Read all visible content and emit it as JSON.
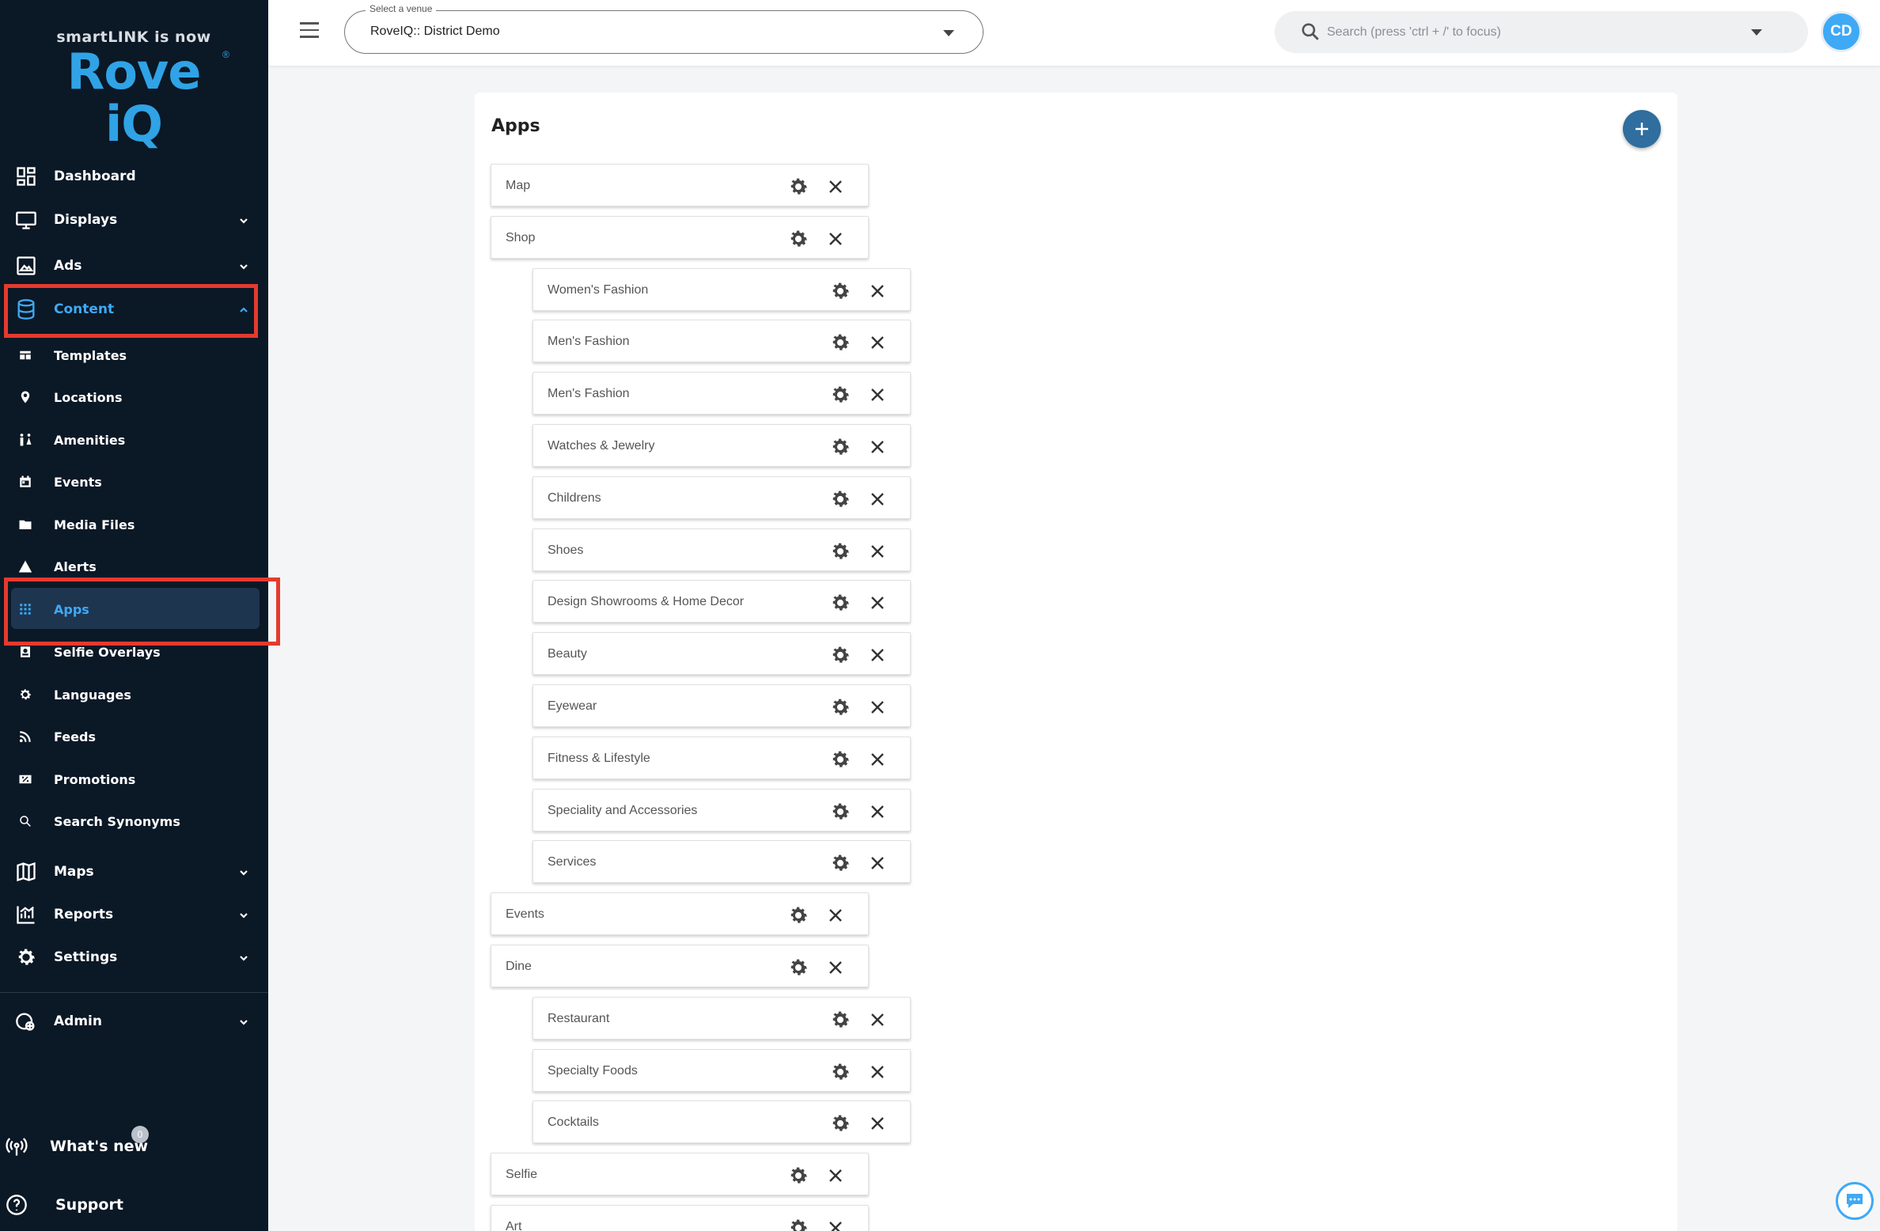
{
  "logo": {
    "tagline": "smartLINK is now",
    "brand": "Rove iQ",
    "reg": "®"
  },
  "topbar": {
    "venue_legend": "Select a venue",
    "venue_value": "RoveIQ:: District Demo",
    "search_placeholder": "Search (press 'ctrl + /' to focus)",
    "avatar_initials": "CD"
  },
  "sidebar": {
    "main": [
      {
        "label": "Dashboard",
        "icon": "dashboard-icon"
      },
      {
        "label": "Displays",
        "icon": "monitor-icon"
      },
      {
        "label": "Ads",
        "icon": "image-icon"
      },
      {
        "label": "Content",
        "icon": "database-icon"
      }
    ],
    "content_sub": [
      {
        "label": "Templates",
        "icon": "template-icon"
      },
      {
        "label": "Locations",
        "icon": "pin-icon"
      },
      {
        "label": "Amenities",
        "icon": "restroom-icon"
      },
      {
        "label": "Events",
        "icon": "calendar-icon"
      },
      {
        "label": "Media Files",
        "icon": "folder-icon"
      },
      {
        "label": "Alerts",
        "icon": "warning-icon"
      },
      {
        "label": "Apps",
        "icon": "grid-icon"
      },
      {
        "label": "Selfie Overlays",
        "icon": "portrait-icon"
      },
      {
        "label": "Languages",
        "icon": "gear-icon"
      },
      {
        "label": "Feeds",
        "icon": "rss-icon"
      },
      {
        "label": "Promotions",
        "icon": "discount-icon"
      },
      {
        "label": "Search Synonyms",
        "icon": "search-icon"
      }
    ],
    "lower": [
      {
        "label": "Maps",
        "icon": "map-icon"
      },
      {
        "label": "Reports",
        "icon": "chart-icon"
      },
      {
        "label": "Settings",
        "icon": "settings-icon"
      }
    ],
    "admin": "Admin",
    "whats_new": "What's new",
    "whats_new_count": "0",
    "support": "Support"
  },
  "main": {
    "title": "Apps",
    "apps": [
      {
        "name": "Map",
        "level": 0
      },
      {
        "name": "Shop",
        "level": 0
      },
      {
        "name": "Women's Fashion",
        "level": 1
      },
      {
        "name": "Men's Fashion",
        "level": 1
      },
      {
        "name": "Men's Fashion",
        "level": 1
      },
      {
        "name": "Watches & Jewelry",
        "level": 1
      },
      {
        "name": "Childrens",
        "level": 1
      },
      {
        "name": "Shoes",
        "level": 1
      },
      {
        "name": "Design Showrooms & Home Decor",
        "level": 1
      },
      {
        "name": "Beauty",
        "level": 1
      },
      {
        "name": "Eyewear",
        "level": 1
      },
      {
        "name": "Fitness & Lifestyle",
        "level": 1
      },
      {
        "name": "Speciality and Accessories",
        "level": 1
      },
      {
        "name": "Services",
        "level": 1
      },
      {
        "name": "Events",
        "level": 0
      },
      {
        "name": "Dine",
        "level": 0
      },
      {
        "name": "Restaurant",
        "level": 1
      },
      {
        "name": "Specialty Foods",
        "level": 1
      },
      {
        "name": "Cocktails",
        "level": 1
      },
      {
        "name": "Selfie",
        "level": 0
      },
      {
        "name": "Art",
        "level": 0
      }
    ]
  },
  "colors": {
    "sidebar_bg": "#0b1826",
    "accent": "#3fa9f5",
    "highlight": "#e53a2e",
    "add_button": "#2f6e9e"
  }
}
